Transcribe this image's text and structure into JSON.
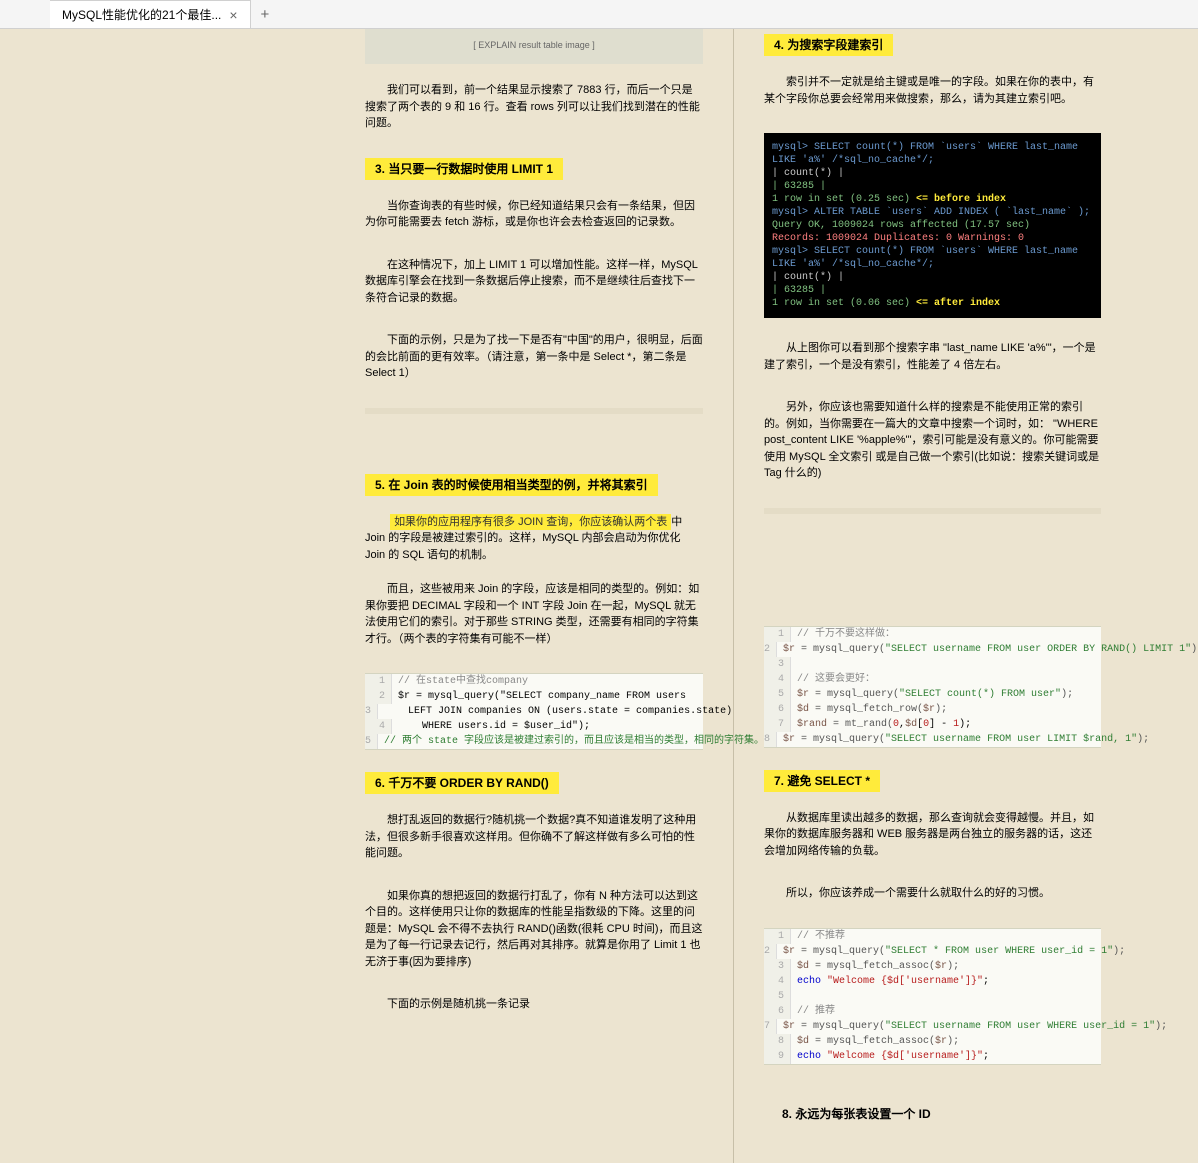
{
  "tab": {
    "title": "MySQL性能优化的21个最佳...",
    "close": "×",
    "new": "+"
  },
  "left": {
    "imgph": "[ EXPLAIN result table image ]",
    "p1": "我们可以看到，前一个结果显示搜索了 7883 行，而后一个只是搜索了两个表的 9 和 16 行。查看 rows 列可以让我们找到潜在的性能问题。",
    "h3": "3. 当只要一行数据时使用 LIMIT 1",
    "p3a": "当你查询表的有些时候，你已经知道结果只会有一条结果，但因为你可能需要去 fetch 游标，或是你也许会去检查返回的记录数。",
    "p3b": "在这种情况下，加上 LIMIT 1 可以增加性能。这样一样，MySQL 数据库引擎会在找到一条数据后停止搜索，而不是继续往后查找下一条符合记录的数据。",
    "p3c": "下面的示例，只是为了找一下是否有\"中国\"的用户，很明显，后面的会比前面的更有效率。（请注意，第一条中是 Select *，第二条是 Select 1）",
    "h5": "5. 在 Join 表的时候使用相当类型的例，并将其索引",
    "hl5": "如果你的应用程序有很多 JOIN 查询，你应该确认两个表",
    "p5a": "中 Join 的字段是被建过索引的。这样，MySQL 内部会启动为你优化 Join 的 SQL 语句的机制。",
    "p5b": "而且，这些被用来 Join 的字段，应该是相同的类型的。例如：如果你要把 DECIMAL 字段和一个 INT 字段 Join 在一起，MySQL 就无法使用它们的索引。对于那些 STRING 类型，还需要有相同的字符集才行。（两个表的字符集有可能不一样）",
    "code5": [
      {
        "ln": "1",
        "txt": "// 在state中查找company",
        "cls": "c-comment"
      },
      {
        "ln": "2",
        "txt": "$r = mysql_query(\"SELECT company_name FROM users"
      },
      {
        "ln": "3",
        "txt": "    LEFT JOIN companies ON (users.state = companies.state)"
      },
      {
        "ln": "4",
        "txt": "    WHERE users.id = $user_id\");"
      },
      {
        "ln": "5",
        "txt": "// 两个 state 字段应该是被建过索引的，而且应该是相当的类型，相同的字符集。",
        "cls": "c-note"
      }
    ],
    "h6": "6. 千万不要 ORDER BY RAND()",
    "p6a": "想打乱返回的数据行?随机挑一个数据?真不知道谁发明了这种用法，但很多新手很喜欢这样用。但你确不了解这样做有多么可怕的性能问题。",
    "p6b": "如果你真的想把返回的数据行打乱了，你有 N 种方法可以达到这个目的。这样使用只让你的数据库的性能呈指数级的下降。这里的问题是：MySQL 会不得不去执行 RAND()函数(很耗 CPU 时间)，而且这是为了每一行记录去记行，然后再对其排序。就算是你用了 Limit 1 也无济于事(因为要排序)",
    "p6c": "下面的示例是随机挑一条记录"
  },
  "right": {
    "h4": "4. 为搜索字段建索引",
    "p4a": "索引并不一定就是给主键或是唯一的字段。如果在你的表中，有某个字段你总要会经常用来做搜索，那么，请为其建立索引吧。",
    "term": {
      "l1": "mysql> SELECT count(*) FROM `users` WHERE last_name LIKE 'a%' /*sql_no_cache*/;",
      "l2": "| count(*) |",
      "l3": "|    63285 |",
      "l4a": "1 row in set (0.25 sec) ",
      "l4b": "<= before index",
      "l5": "mysql> ALTER TABLE `users` ADD INDEX ( `last_name` );",
      "l6": "Query OK, 1009024 rows affected (17.57 sec)",
      "l7": "Records: 1009024  Duplicates: 0  Warnings: 0",
      "l8": "mysql> SELECT count(*) FROM `users` WHERE last_name LIKE 'a%' /*sql_no_cache*/;",
      "l9": "| count(*) |",
      "l10": "|    63285 |",
      "l11a": "1 row in set (0.06 sec) ",
      "l11b": "<= after index"
    },
    "p4b": "从上图你可以看到那个搜索字串 \"last_name LIKE 'a%'\"，一个是建了索引，一个是没有索引，性能差了 4 倍左右。",
    "p4c": "另外，你应该也需要知道什么样的搜索是不能使用正常的索引的。例如，当你需要在一篇大的文章中搜索一个词时，如： \"WHERE post_content LIKE '%apple%'\"，索引可能是没有意义的。你可能需要使用 MySQL 全文索引 或是自己做一个索引(比如说：搜索关键词或是 Tag 什么的)",
    "code6": [
      {
        "ln": "1",
        "parts": [
          {
            "t": "// 千万不要这样做：",
            "c": "c-comment"
          }
        ]
      },
      {
        "ln": "2",
        "parts": [
          {
            "t": "$r",
            "c": "c-var"
          },
          {
            "t": " = mysql_query(",
            "c": "c-func"
          },
          {
            "t": "\"SELECT username FROM user ORDER BY RAND() LIMIT 1\"",
            "c": "c-green"
          },
          {
            "t": ");",
            "c": "c-func"
          }
        ]
      },
      {
        "ln": "3",
        "parts": [
          {
            "t": " "
          }
        ]
      },
      {
        "ln": "4",
        "parts": [
          {
            "t": "// 这要会更好：",
            "c": "c-comment"
          }
        ]
      },
      {
        "ln": "5",
        "parts": [
          {
            "t": "$r",
            "c": "c-var"
          },
          {
            "t": " = mysql_query(",
            "c": "c-func"
          },
          {
            "t": "\"SELECT count(*) FROM user\"",
            "c": "c-green"
          },
          {
            "t": ");",
            "c": "c-func"
          }
        ]
      },
      {
        "ln": "6",
        "parts": [
          {
            "t": "$d",
            "c": "c-var"
          },
          {
            "t": " = mysql_fetch_row(",
            "c": "c-func"
          },
          {
            "t": "$r",
            "c": "c-var"
          },
          {
            "t": ");",
            "c": "c-func"
          }
        ]
      },
      {
        "ln": "7",
        "parts": [
          {
            "t": "$rand",
            "c": "c-var"
          },
          {
            "t": " = mt_rand(",
            "c": "c-func"
          },
          {
            "t": "0",
            "c": "c-num"
          },
          {
            "t": ",",
            "c": ""
          },
          {
            "t": "$d",
            "c": "c-var"
          },
          {
            "t": "[",
            "c": ""
          },
          {
            "t": "0",
            "c": "c-num"
          },
          {
            "t": "] - ",
            "c": ""
          },
          {
            "t": "1",
            "c": "c-num"
          },
          {
            "t": ");",
            "c": ""
          }
        ]
      },
      {
        "ln": "8",
        "parts": [
          {
            "t": "$r",
            "c": "c-var"
          },
          {
            "t": " = mysql_query(",
            "c": "c-func"
          },
          {
            "t": "\"SELECT username FROM user LIMIT $rand, 1\"",
            "c": "c-green"
          },
          {
            "t": ");",
            "c": "c-func"
          }
        ]
      }
    ],
    "h7": "7. 避免 SELECT *",
    "p7a": "从数据库里读出越多的数据，那么查询就会变得越慢。并且，如果你的数据库服务器和 WEB 服务器是两台独立的服务器的话，这还会增加网络传输的负载。",
    "p7b": "所以，你应该养成一个需要什么就取什么的好的习惯。",
    "code7": [
      {
        "ln": "1",
        "parts": [
          {
            "t": "// 不推荐",
            "c": "c-comment"
          }
        ]
      },
      {
        "ln": "2",
        "parts": [
          {
            "t": "$r",
            "c": "c-var"
          },
          {
            "t": " = mysql_query(",
            "c": "c-func"
          },
          {
            "t": "\"SELECT * FROM user WHERE user_id = 1\"",
            "c": "c-green"
          },
          {
            "t": ");",
            "c": "c-func"
          }
        ]
      },
      {
        "ln": "3",
        "parts": [
          {
            "t": "$d",
            "c": "c-var"
          },
          {
            "t": " = mysql_fetch_assoc(",
            "c": "c-func"
          },
          {
            "t": "$r",
            "c": "c-var"
          },
          {
            "t": ");",
            "c": "c-func"
          }
        ]
      },
      {
        "ln": "4",
        "parts": [
          {
            "t": "echo ",
            "c": "c-key"
          },
          {
            "t": "\"Welcome {$d['username']}\"",
            "c": "c-num"
          },
          {
            "t": ";",
            "c": ""
          }
        ]
      },
      {
        "ln": "5",
        "parts": [
          {
            "t": " "
          }
        ]
      },
      {
        "ln": "6",
        "parts": [
          {
            "t": "// 推荐",
            "c": "c-comment"
          }
        ]
      },
      {
        "ln": "7",
        "parts": [
          {
            "t": "$r",
            "c": "c-var"
          },
          {
            "t": " = mysql_query(",
            "c": "c-func"
          },
          {
            "t": "\"SELECT username FROM user WHERE user_id = 1\"",
            "c": "c-green"
          },
          {
            "t": ");",
            "c": "c-func"
          }
        ]
      },
      {
        "ln": "8",
        "parts": [
          {
            "t": "$d",
            "c": "c-var"
          },
          {
            "t": " = mysql_fetch_assoc(",
            "c": "c-func"
          },
          {
            "t": "$r",
            "c": "c-var"
          },
          {
            "t": ");",
            "c": "c-func"
          }
        ]
      },
      {
        "ln": "9",
        "parts": [
          {
            "t": "echo ",
            "c": "c-key"
          },
          {
            "t": "\"Welcome {$d['username']}\"",
            "c": "c-num"
          },
          {
            "t": ";",
            "c": ""
          }
        ]
      }
    ],
    "h8": "8. 永远为每张表设置一个 ID"
  }
}
